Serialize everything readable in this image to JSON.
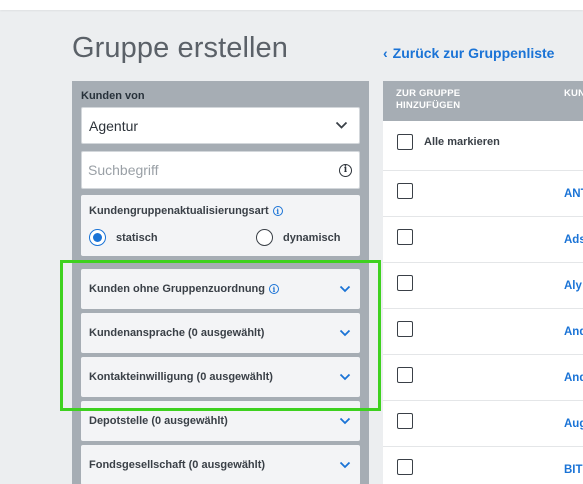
{
  "page": {
    "title": "Gruppe erstellen",
    "back_link": "Zurück zur Gruppenliste"
  },
  "filters": {
    "customers_from_label": "Kunden von",
    "customers_from_value": "Agentur",
    "search_placeholder": "Suchbegriff",
    "update_type": {
      "title": "Kundengruppenaktualisierungsart",
      "options": [
        {
          "label": "statisch",
          "selected": true
        },
        {
          "label": "dynamisch",
          "selected": false
        }
      ]
    },
    "accordion": [
      "Kunden ohne Gruppenzuordnung",
      "Kundenansprache (0 ausgewählt)",
      "Kontakteinwilligung (0 ausgewählt)",
      "Depotstelle (0 ausgewählt)",
      "Fondsgesellschaft (0 ausgewählt)"
    ]
  },
  "table": {
    "col_add_line1": "ZUR GRUPPE",
    "col_add_line2": "HINZUFÜGEN",
    "col_customer": "KUN",
    "select_all": "Alle markieren",
    "rows": [
      "ANT",
      "Ads",
      "Aly",
      "And",
      "And",
      "Aug",
      "BIT"
    ]
  },
  "colors": {
    "accent": "#1a73d6",
    "highlight": "#3ed11f",
    "panel_header": "#a6adb4",
    "background": "#eceef0"
  }
}
